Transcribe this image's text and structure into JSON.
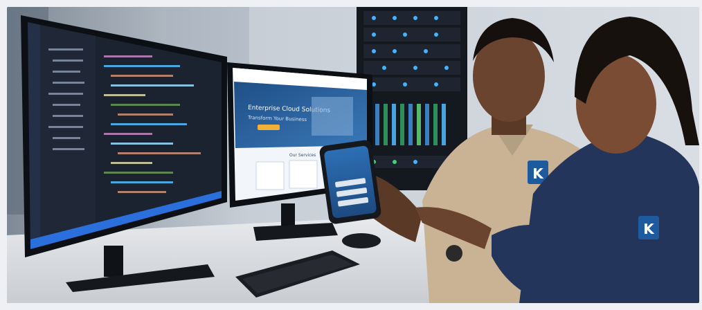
{
  "website": {
    "headline": "Enterprise Cloud Solutions",
    "subheadline": "Transform Your Business",
    "section_title": "Our Services"
  },
  "badges": {
    "man_shirt_logo_letter": "K",
    "woman_shirt_logo_letter": "K"
  },
  "colors": {
    "ide_background": "#1b2230",
    "website_header": "#1f4f86",
    "man_shirt": "#c9b394",
    "woman_shirt": "#23355a",
    "logo_badge": "#1e5a9e"
  }
}
